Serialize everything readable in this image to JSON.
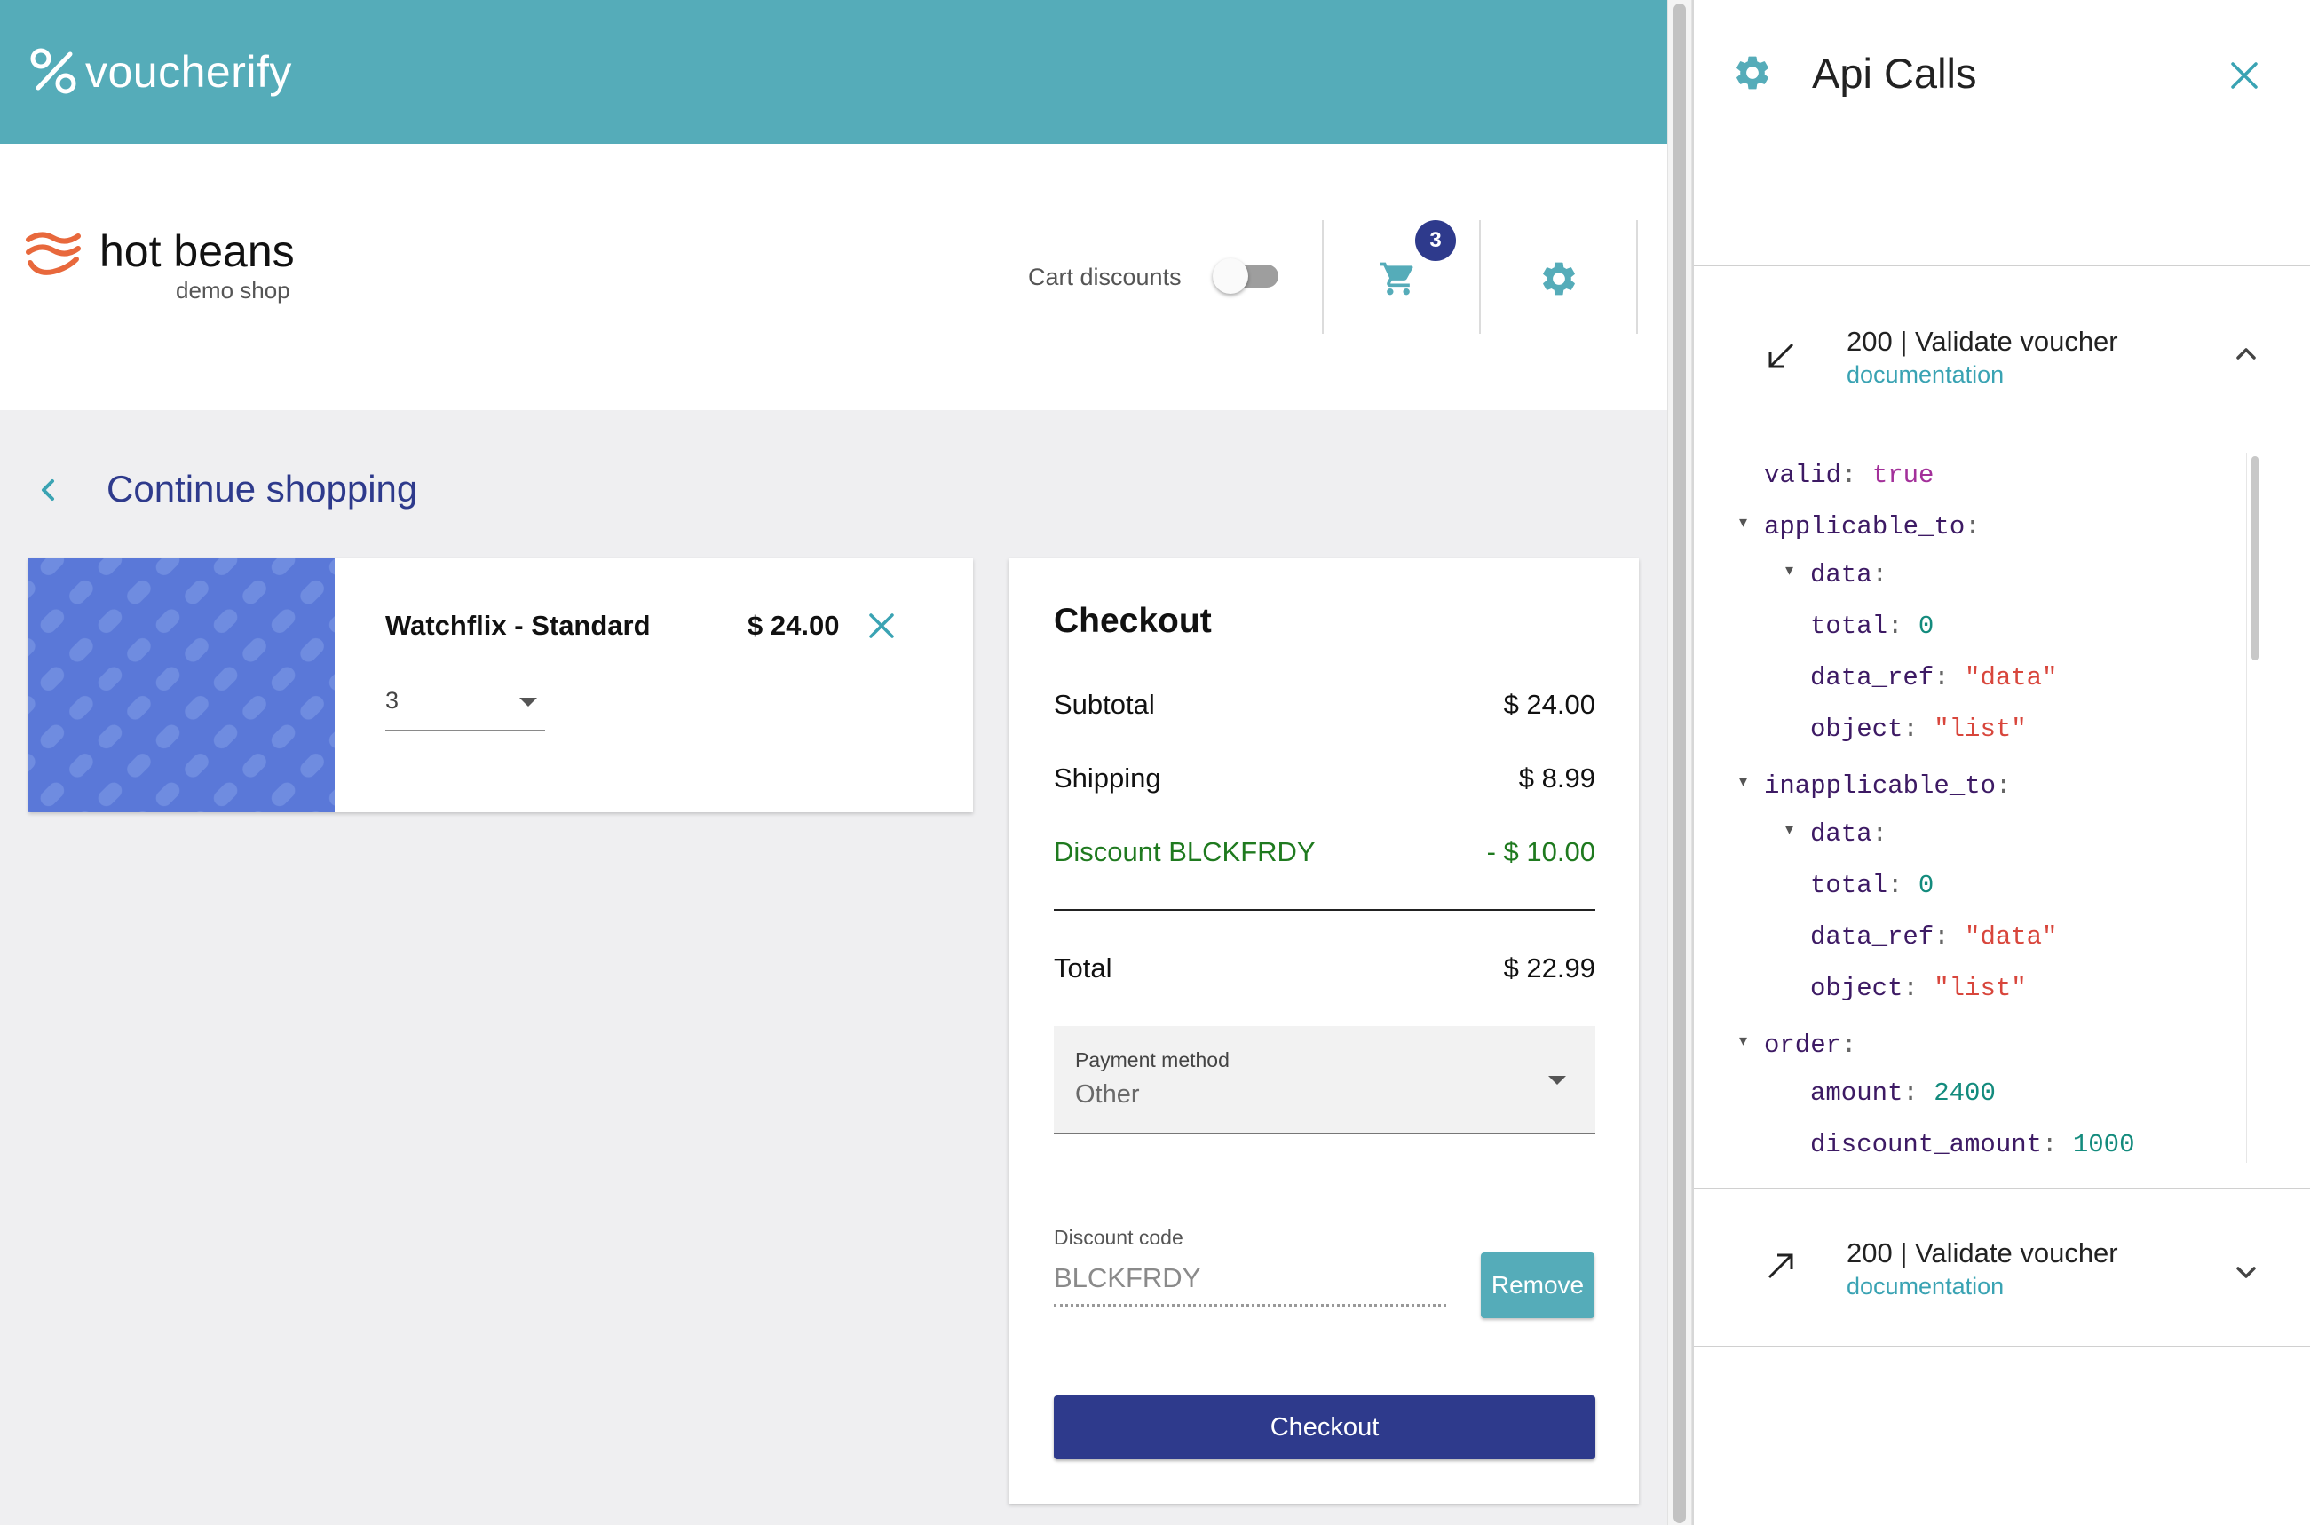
{
  "brand": {
    "name": "voucherify",
    "color": "#55acb9"
  },
  "shop": {
    "name": "hot beans",
    "subtitle": "demo shop",
    "logo_icon": "waves-logo-icon"
  },
  "header": {
    "cart_discounts_label": "Cart discounts",
    "cart_discounts_enabled": false,
    "cart_count": "3"
  },
  "nav": {
    "continue_label": "Continue shopping"
  },
  "cart_items": [
    {
      "name": "Watchflix - Standard",
      "price": "$ 24.00",
      "quantity": "3"
    }
  ],
  "checkout": {
    "title": "Checkout",
    "rows": [
      {
        "label": "Subtotal",
        "value": "$ 24.00"
      },
      {
        "label": "Shipping",
        "value": "$ 8.99"
      },
      {
        "label": "Discount BLCKFRDY",
        "value": "- $ 10.00"
      }
    ],
    "total_label": "Total",
    "total_value": "$ 22.99",
    "payment_label": "Payment method",
    "payment_value": "Other",
    "discount_label": "Discount code",
    "discount_value": "BLCKFRDY",
    "remove_label": "Remove",
    "checkout_label": "Checkout"
  },
  "panel": {
    "title": "Api Calls",
    "calls": [
      {
        "title": "200 | Validate voucher",
        "doc": "documentation",
        "direction": "incoming",
        "expanded": true
      },
      {
        "title": "200 | Validate voucher",
        "doc": "documentation",
        "direction": "outgoing",
        "expanded": false
      }
    ],
    "json_lines": [
      {
        "key": "valid",
        "value": "true",
        "type": "bool"
      },
      {
        "key": "applicable_to",
        "value": "",
        "type": "node"
      },
      {
        "key": "data",
        "value": "",
        "type": "node"
      },
      {
        "key": "total",
        "value": "0",
        "type": "num"
      },
      {
        "key": "data_ref",
        "value": "\"data\"",
        "type": "str"
      },
      {
        "key": "object",
        "value": "\"list\"",
        "type": "str"
      },
      {
        "key": "inapplicable_to",
        "value": "",
        "type": "node"
      },
      {
        "key": "data",
        "value": "",
        "type": "node"
      },
      {
        "key": "total",
        "value": "0",
        "type": "num"
      },
      {
        "key": "data_ref",
        "value": "\"data\"",
        "type": "str"
      },
      {
        "key": "object",
        "value": "\"list\"",
        "type": "str"
      },
      {
        "key": "order",
        "value": "",
        "type": "node"
      },
      {
        "key": "amount",
        "value": "2400",
        "type": "num"
      },
      {
        "key": "discount_amount",
        "value": "1000",
        "type": "num"
      }
    ]
  },
  "colors": {
    "accent": "#55acb9",
    "primary": "#2e3a8c",
    "discount": "#1f7a1f",
    "product_tile": "#5a78d8"
  }
}
